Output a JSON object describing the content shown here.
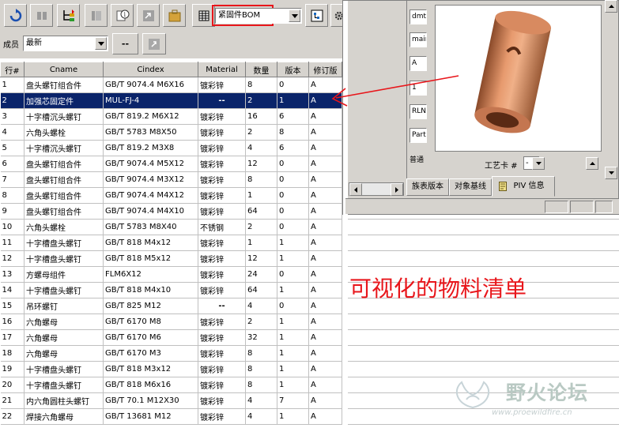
{
  "toolbar": {
    "bom_select_value": "紧固件BOM",
    "member_label": "成员",
    "member_select_value": "最新",
    "dash_button": "--"
  },
  "table": {
    "columns": [
      "行#",
      "Cname",
      "Cindex",
      "Material",
      "数量",
      "版本",
      "修订版"
    ],
    "rows": [
      [
        "1",
        "盘头螺钉组合件",
        "GB/T 9074.4  M6X16",
        "镀彩锌",
        "8",
        "0",
        "A"
      ],
      [
        "2",
        "加强芯固定件",
        "MUL-FJ-4",
        "--",
        "2",
        "1",
        "A"
      ],
      [
        "3",
        "十字槽沉头螺钉",
        "GB/T 819.2  M6X12",
        "镀彩锌",
        "16",
        "6",
        "A"
      ],
      [
        "4",
        "六角头螺栓",
        "GB/T 5783   M8X50",
        "镀彩锌",
        "2",
        "8",
        "A"
      ],
      [
        "5",
        "十字槽沉头螺钉",
        "GB/T 819.2  M3X8",
        "镀彩锌",
        "4",
        "6",
        "A"
      ],
      [
        "6",
        "盘头螺钉组合件",
        "GB/T 9074.4  M5X12",
        "镀彩锌",
        "12",
        "0",
        "A"
      ],
      [
        "7",
        "盘头螺钉组合件",
        "GB/T 9074.4  M3X12",
        "镀彩锌",
        "8",
        "0",
        "A"
      ],
      [
        "8",
        "盘头螺钉组合件",
        "GB/T 9074.4  M4X12",
        "镀彩锌",
        "1",
        "0",
        "A"
      ],
      [
        "9",
        "盘头螺钉组合件",
        "GB/T 9074.4  M4X10",
        "镀彩锌",
        "64",
        "0",
        "A"
      ],
      [
        "10",
        "六角头螺栓",
        "GB/T 5783   M8X40",
        "不锈钢",
        "2",
        "0",
        "A"
      ],
      [
        "11",
        "十字槽盘头螺钉",
        "GB/T 818  M4x12",
        "镀彩锌",
        "1",
        "1",
        "A"
      ],
      [
        "12",
        "十字槽盘头螺钉",
        "GB/T 818  M5x12",
        "镀彩锌",
        "12",
        "1",
        "A"
      ],
      [
        "13",
        "方螺母组件",
        "FLM6X12",
        "镀彩锌",
        "24",
        "0",
        "A"
      ],
      [
        "14",
        "十字槽盘头螺钉",
        "GB/T 818  M4x10",
        "镀彩锌",
        "64",
        "1",
        "A"
      ],
      [
        "15",
        "吊环螺钉",
        "GB/T 825    M12",
        "--",
        "4",
        "0",
        "A"
      ],
      [
        "16",
        "六角螺母",
        "GB/T 6170  M8",
        "镀彩锌",
        "2",
        "1",
        "A"
      ],
      [
        "17",
        "六角螺母",
        "GB/T 6170  M6",
        "镀彩锌",
        "32",
        "1",
        "A"
      ],
      [
        "18",
        "六角螺母",
        "GB/T 6170  M3",
        "镀彩锌",
        "8",
        "1",
        "A"
      ],
      [
        "19",
        "十字槽盘头螺钉",
        "GB/T 818  M3x12",
        "镀彩锌",
        "8",
        "1",
        "A"
      ],
      [
        "20",
        "十字槽盘头螺钉",
        "GB/T 818  M6x16",
        "镀彩锌",
        "8",
        "1",
        "A"
      ],
      [
        "21",
        "内六角圆柱头螺钉",
        "GB/T 70.1  M12X30",
        "镀彩锌",
        "4",
        "7",
        "A"
      ],
      [
        "22",
        "焊接六角螺母",
        "GB/T 13681  M12",
        "镀彩锌",
        "4",
        "1",
        "A"
      ]
    ],
    "selected_row_index": 1
  },
  "panel": {
    "fields": [
      "dmt-",
      "main",
      "A",
      "1",
      "RLN",
      "Part"
    ],
    "field_label_7": "普通",
    "process_card_label": "工艺卡 #",
    "process_card_value": "-",
    "tabs": [
      "族表版本",
      "对象基线",
      "PIV 信息"
    ],
    "active_tab_index": 2
  },
  "caption": "可视化的物料清单",
  "watermark": {
    "name": "野火论坛",
    "url": "www.proewildfire.cn"
  },
  "colors": {
    "selection": "#0a246a",
    "caption": "#e8161b",
    "highlight_box": "#e8161b",
    "model_copper": "#d2825a"
  }
}
